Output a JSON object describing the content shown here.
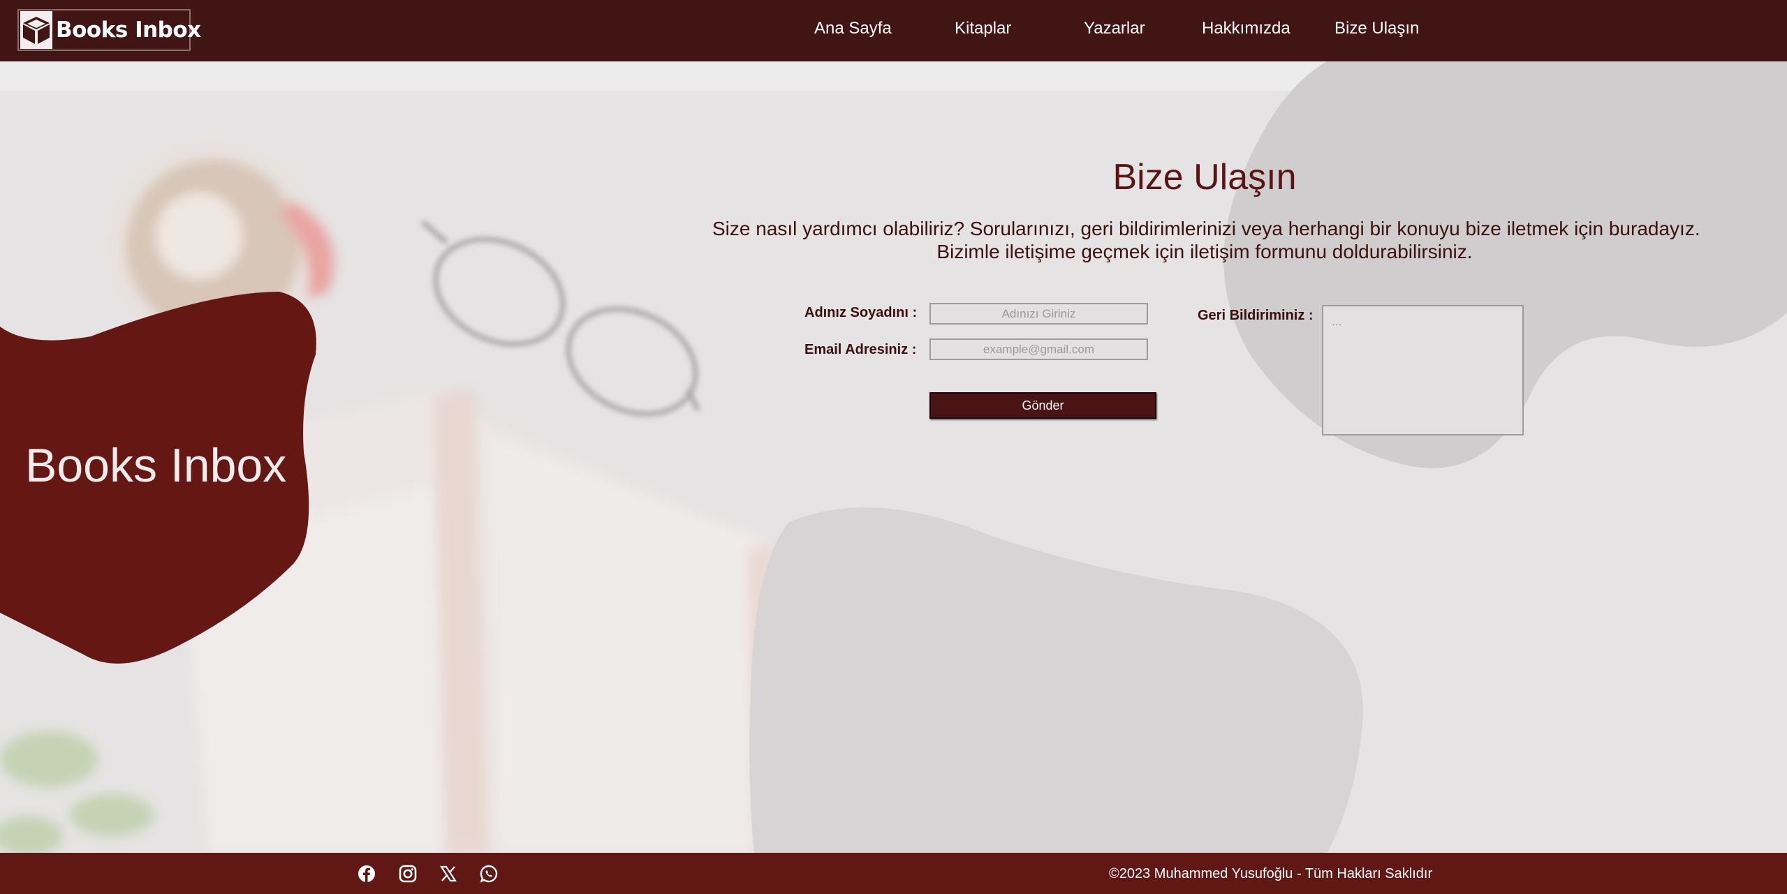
{
  "brand": {
    "name": "Books Inbox",
    "logo_icon": "open-box-icon"
  },
  "nav": {
    "items": [
      {
        "label": "Ana Sayfa"
      },
      {
        "label": "Kitaplar"
      },
      {
        "label": "Yazarlar"
      },
      {
        "label": "Hakkımızda"
      },
      {
        "label": "Bize Ulaşın"
      }
    ]
  },
  "hero": {
    "title": "Books Inbox"
  },
  "contact": {
    "title": "Bize Ulaşın",
    "description_line1": "Size nasıl yardımcı olabiliriz? Sorularınızı, geri bildirimlerinizi veya herhangi bir konuyu bize iletmek için buradayız.",
    "description_line2": "Bizimle iletişime geçmek için iletişim formunu doldurabilirsiniz.",
    "name_label": "Adınız Soyadını :",
    "name_placeholder": "Adınızı Giriniz",
    "email_label": "Email Adresiniz :",
    "email_placeholder": "example@gmail.com",
    "feedback_label": "Geri Bildiriminiz :",
    "feedback_placeholder": "...",
    "submit_label": "Gönder"
  },
  "footer": {
    "social": [
      "facebook-icon",
      "instagram-icon",
      "x-icon",
      "whatsapp-icon"
    ],
    "copyright": "©2023 Muhammed Yusufoğlu - Tüm Hakları Saklıdır"
  },
  "colors": {
    "header_bg": "#421515",
    "footer_bg": "#611714",
    "hero_blob": "#651813",
    "accent_text": "#5a1414",
    "button_bg": "#4a1414"
  }
}
